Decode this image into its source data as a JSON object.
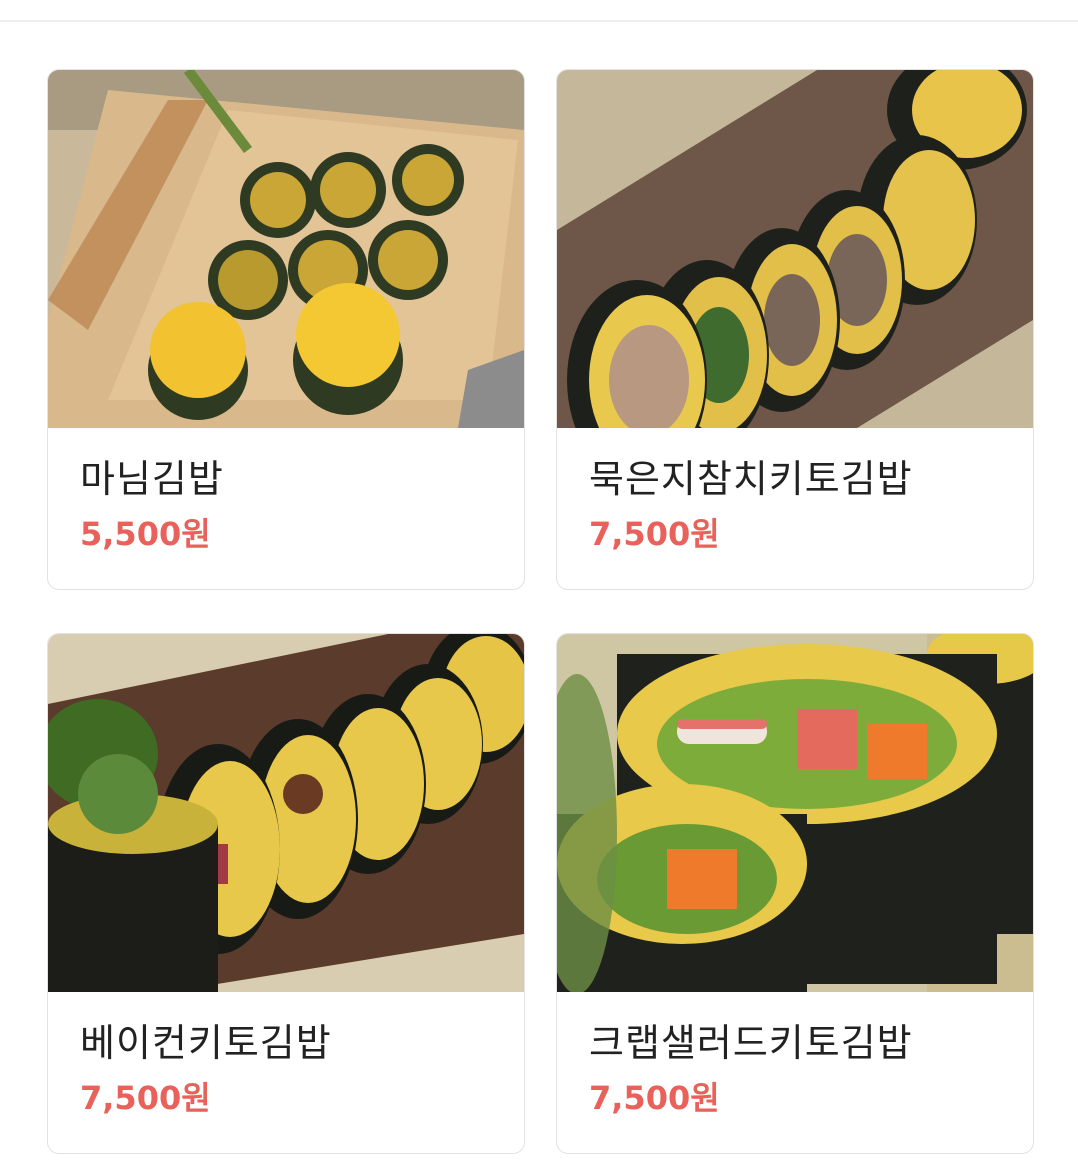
{
  "menu": {
    "items": [
      {
        "name": "마님김밥",
        "price": "5,500원",
        "image": "manim-kimbap-photo"
      },
      {
        "name": "묵은지참치키토김밥",
        "price": "7,500원",
        "image": "mukeunji-tuna-keto-kimbap-photo"
      },
      {
        "name": "베이컨키토김밥",
        "price": "7,500원",
        "image": "bacon-keto-kimbap-photo"
      },
      {
        "name": "크랩샐러드키토김밥",
        "price": "7,500원",
        "image": "crab-salad-keto-kimbap-photo"
      }
    ]
  },
  "colors": {
    "price": "#e8615a",
    "name": "#222222",
    "card_border": "#e2e2e2"
  }
}
